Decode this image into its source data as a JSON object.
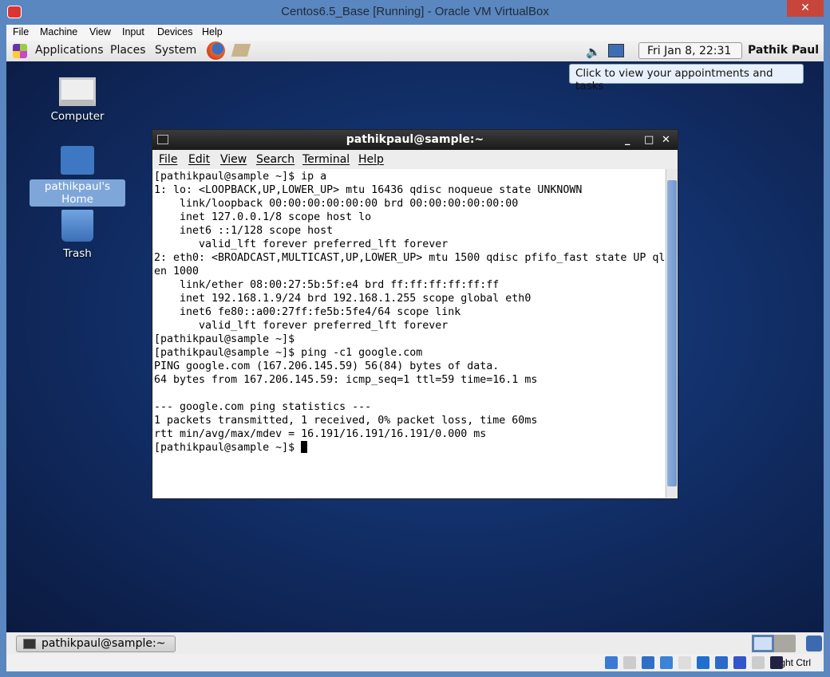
{
  "window": {
    "title": "Centos6.5_Base [Running] - Oracle VM VirtualBox",
    "close": "✕"
  },
  "vbox_menu": [
    "File",
    "Machine",
    "View",
    "Input",
    "Devices",
    "Help"
  ],
  "gnome_panel": {
    "menus": [
      "Applications",
      "Places",
      "System"
    ],
    "clock": "Fri Jan  8, 22:31",
    "user": "Pathik Paul",
    "tooltip": "Click to view your appointments and tasks"
  },
  "desktop_icons": [
    {
      "label": "Computer",
      "icon": "computer-icon"
    },
    {
      "label": "pathikpaul's Home",
      "icon": "home-folder-icon",
      "selected": true
    },
    {
      "label": "Trash",
      "icon": "trash-icon"
    }
  ],
  "terminal": {
    "title": "pathikpaul@sample:~",
    "controls": [
      "_",
      "□",
      "✕"
    ],
    "menu": [
      "File",
      "Edit",
      "View",
      "Search",
      "Terminal",
      "Help"
    ],
    "lines": [
      "[pathikpaul@sample ~]$ ip a",
      "1: lo: <LOOPBACK,UP,LOWER_UP> mtu 16436 qdisc noqueue state UNKNOWN",
      "    link/loopback 00:00:00:00:00:00 brd 00:00:00:00:00:00",
      "    inet 127.0.0.1/8 scope host lo",
      "    inet6 ::1/128 scope host",
      "       valid_lft forever preferred_lft forever",
      "2: eth0: <BROADCAST,MULTICAST,UP,LOWER_UP> mtu 1500 qdisc pfifo_fast state UP ql",
      "en 1000",
      "    link/ether 08:00:27:5b:5f:e4 brd ff:ff:ff:ff:ff:ff",
      "    inet 192.168.1.9/24 brd 192.168.1.255 scope global eth0",
      "    inet6 fe80::a00:27ff:fe5b:5fe4/64 scope link",
      "       valid_lft forever preferred_lft forever",
      "[pathikpaul@sample ~]$",
      "[pathikpaul@sample ~]$ ping -c1 google.com",
      "PING google.com (167.206.145.59) 56(84) bytes of data.",
      "64 bytes from 167.206.145.59: icmp_seq=1 ttl=59 time=16.1 ms",
      "",
      "--- google.com ping statistics ---",
      "1 packets transmitted, 1 received, 0% packet loss, time 60ms",
      "rtt min/avg/max/mdev = 16.191/16.191/16.191/0.000 ms"
    ],
    "prompt": "[pathikpaul@sample ~]$ "
  },
  "taskbar": {
    "item": "pathikpaul@sample:~"
  },
  "statusbar": {
    "host_key": "Right Ctrl",
    "icons": [
      "hard-disk-icon",
      "optical-drive-icon",
      "network-icon",
      "usb-icon",
      "shared-folder-icon",
      "display-icon",
      "video-capture-icon",
      "cpu-icon",
      "mouse-icon",
      "keyboard-arrow-icon"
    ]
  }
}
